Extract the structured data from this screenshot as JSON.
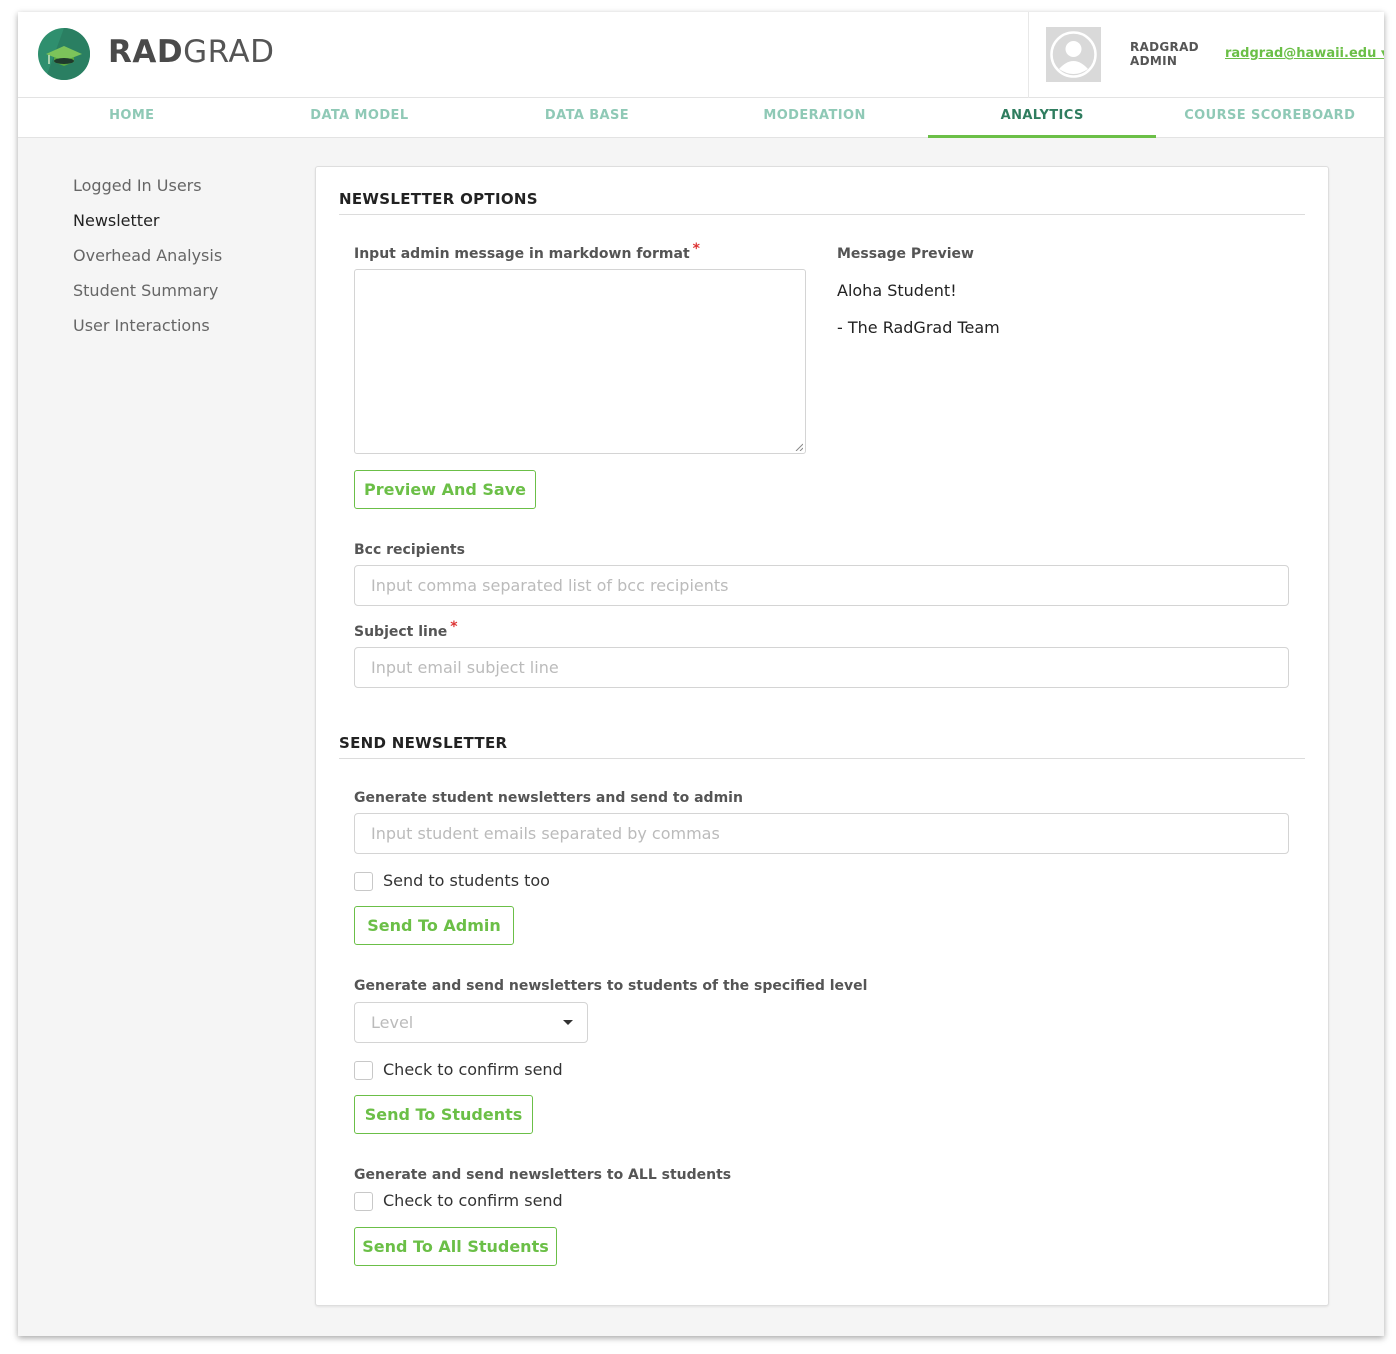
{
  "brand": {
    "name_bold": "RAD",
    "name_rest": "GRAD"
  },
  "user": {
    "name_line1": "RADGRAD",
    "name_line2": "ADMIN",
    "email": "radgrad@hawaii.edu ▾"
  },
  "nav": {
    "items": [
      {
        "label": "HOME"
      },
      {
        "label": "DATA MODEL"
      },
      {
        "label": "DATA BASE"
      },
      {
        "label": "MODERATION"
      },
      {
        "label": "ANALYTICS"
      },
      {
        "label": "COURSE SCOREBOARD"
      }
    ],
    "active": "ANALYTICS"
  },
  "sidebar": {
    "items": [
      {
        "label": "Logged In Users"
      },
      {
        "label": "Newsletter"
      },
      {
        "label": "Overhead Analysis"
      },
      {
        "label": "Student Summary"
      },
      {
        "label": "User Interactions"
      }
    ],
    "active": "Newsletter"
  },
  "options": {
    "title": "NEWSLETTER OPTIONS",
    "message_label": "Input admin message in markdown format",
    "required_mark": "*",
    "message_value": "",
    "preview_label": "Message Preview",
    "preview_line1": "Aloha Student!",
    "preview_line2": "- The RadGrad Team",
    "preview_button": "Preview And Save",
    "bcc_label": "Bcc recipients",
    "bcc_placeholder": "Input comma separated list of bcc recipients",
    "subject_label": "Subject line",
    "subject_placeholder": "Input email subject line"
  },
  "send": {
    "title": "SEND NEWSLETTER",
    "admin_label": "Generate student newsletters and send to admin",
    "admin_placeholder": "Input student emails separated by commas",
    "students_too_label": "Send to students too",
    "send_admin_button": "Send To Admin",
    "level_label": "Generate and send newsletters to students of the specified level",
    "level_placeholder": "Level",
    "confirm_label_1": "Check to confirm send",
    "send_students_button": "Send To Students",
    "all_label": "Generate and send newsletters to ALL students",
    "confirm_label_2": "Check to confirm send",
    "send_all_button": "Send To All Students"
  },
  "colors": {
    "accent": "#6bbf47",
    "nav_text": "#8fc9b6",
    "nav_active": "#2f7d5f",
    "logo": "#2f8f6e"
  }
}
